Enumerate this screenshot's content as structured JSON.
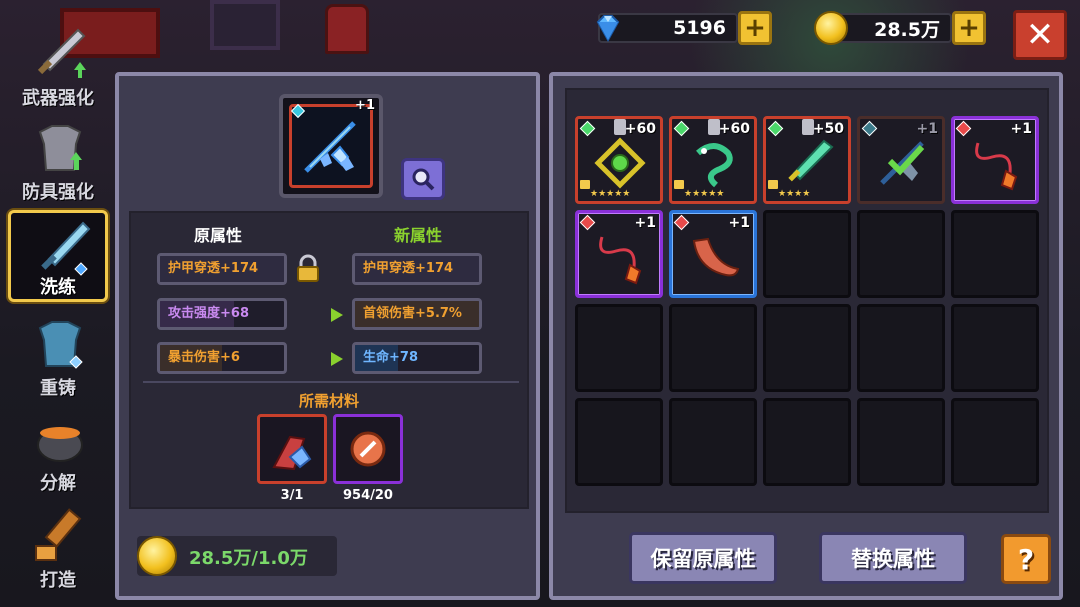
{
  "currency": {
    "gems": "5196",
    "gold": "28.5万"
  },
  "nav": [
    {
      "label": "武器强化",
      "icon": "sword-upgrade-icon"
    },
    {
      "label": "防具强化",
      "icon": "armor-upgrade-icon"
    },
    {
      "label": "洗练",
      "icon": "reforge-sword-icon"
    },
    {
      "label": "重铸",
      "icon": "recast-armor-icon"
    },
    {
      "label": "分解",
      "icon": "cauldron-icon"
    },
    {
      "label": "打造",
      "icon": "forge-hammer-icon"
    }
  ],
  "left": {
    "weapon_level": "+1",
    "original_title": "原属性",
    "new_title": "新属性",
    "original_stats": [
      "护甲穿透+174",
      "攻击强度+68",
      "暴击伤害+6"
    ],
    "new_stats": [
      "护甲穿透+174",
      "首领伤害+5.7%",
      "生命+78"
    ],
    "materials_title": "所需材料",
    "materials": [
      {
        "count": "3/1",
        "icon": "weapon-shard-icon"
      },
      {
        "count": "954/20",
        "icon": "reforge-stone-icon"
      }
    ],
    "gold_cost": "28.5万/1.0万"
  },
  "inventory": [
    {
      "level": "+60",
      "icon": "green-gem-ring-icon",
      "stars": "★★★★★",
      "locked": true,
      "rarity": "orange"
    },
    {
      "level": "+60",
      "icon": "snake-icon",
      "stars": "★★★★★",
      "locked": true,
      "rarity": "orange"
    },
    {
      "level": "+50",
      "icon": "jade-sword-icon",
      "stars": "★★★★",
      "locked": true,
      "rarity": "orange"
    },
    {
      "level": "+1",
      "icon": "ice-crossbow-icon",
      "stars": "",
      "locked": false,
      "rarity": "gray"
    },
    {
      "level": "+1",
      "icon": "fire-whip-icon",
      "stars": "",
      "locked": false,
      "rarity": "purple"
    },
    {
      "level": "+1",
      "icon": "fire-whip-icon",
      "stars": "",
      "locked": false,
      "rarity": "purple"
    },
    {
      "level": "+1",
      "icon": "boomerang-icon",
      "stars": "",
      "locked": false,
      "rarity": "blue"
    }
  ],
  "buttons": {
    "keep": "保留原属性",
    "replace": "替换属性",
    "help": "?",
    "close": "✕"
  },
  "colors": {
    "original_title": "#ffffff",
    "new_title": "#8ad12e",
    "stat_orange": "#f0a030",
    "stat_purple": "#c98af0",
    "stat_blue": "#6fb6ff"
  }
}
